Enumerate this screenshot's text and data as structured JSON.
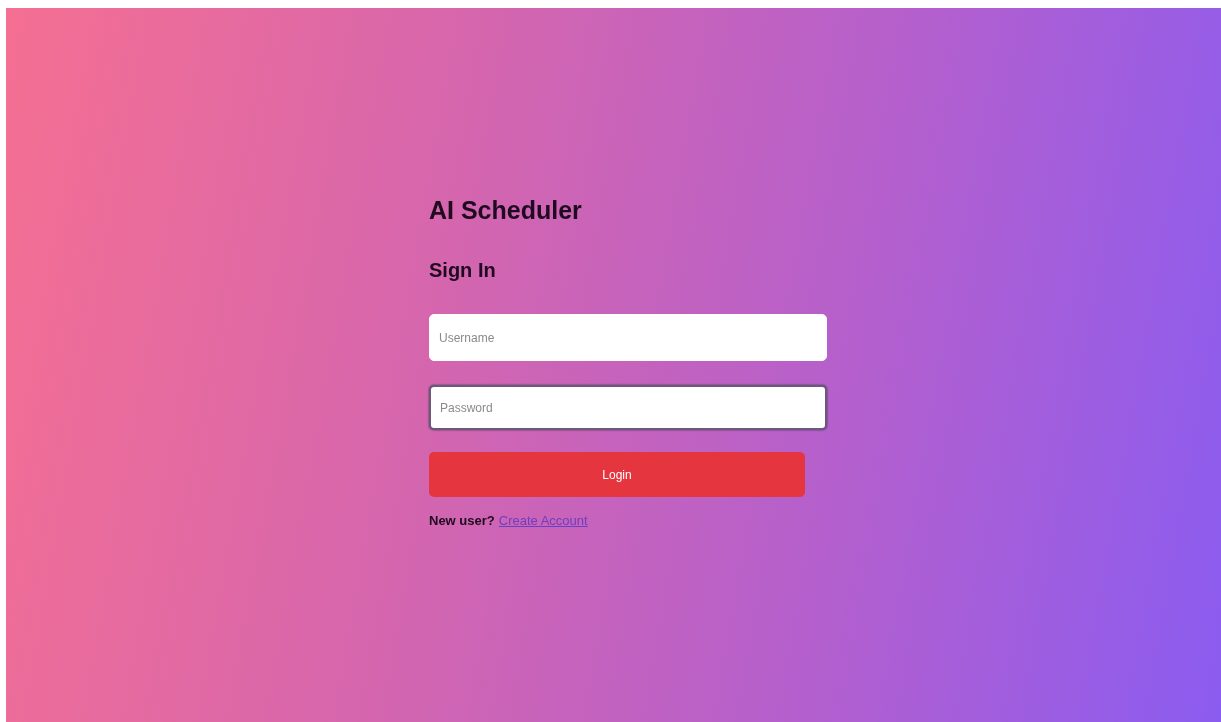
{
  "app_title": "AI Scheduler",
  "form_title": "Sign In",
  "fields": [
    {
      "placeholder": "Username",
      "focused": false
    },
    {
      "placeholder": "Password",
      "focused": true
    }
  ],
  "submit_button": "Login",
  "footer": {
    "text": "New user?",
    "link": "Create Account"
  }
}
